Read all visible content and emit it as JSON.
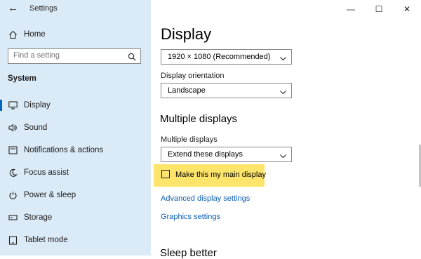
{
  "window": {
    "title": "Settings",
    "minimize": "—",
    "maximize": "☐",
    "close": "✕"
  },
  "sidebar": {
    "home_label": "Home",
    "search": {
      "placeholder": "Find a setting",
      "value": ""
    },
    "section_label": "System",
    "items": [
      {
        "label": "Display",
        "icon": "monitor-icon",
        "selected": true
      },
      {
        "label": "Sound",
        "icon": "speaker-icon"
      },
      {
        "label": "Notifications & actions",
        "icon": "notifications-icon"
      },
      {
        "label": "Focus assist",
        "icon": "moon-icon"
      },
      {
        "label": "Power & sleep",
        "icon": "power-icon"
      },
      {
        "label": "Storage",
        "icon": "storage-icon"
      },
      {
        "label": "Tablet mode",
        "icon": "tablet-icon"
      }
    ]
  },
  "main": {
    "title": "Display",
    "resolution": {
      "value": "1920 × 1080 (Recommended)"
    },
    "orientation": {
      "label": "Display orientation",
      "value": "Landscape"
    },
    "multiple_displays": {
      "heading": "Multiple displays",
      "label": "Multiple displays",
      "value": "Extend these displays",
      "main_display_checkbox": {
        "label": "Make this my main display",
        "checked": false
      }
    },
    "links": {
      "advanced": "Advanced display settings",
      "graphics": "Graphics settings"
    },
    "next_heading": "Sleep better"
  },
  "colors": {
    "sidebar_bg": "#dbeaf7",
    "accent": "#0067c0",
    "link": "#0a5fb4",
    "highlight": "#fde46b"
  }
}
